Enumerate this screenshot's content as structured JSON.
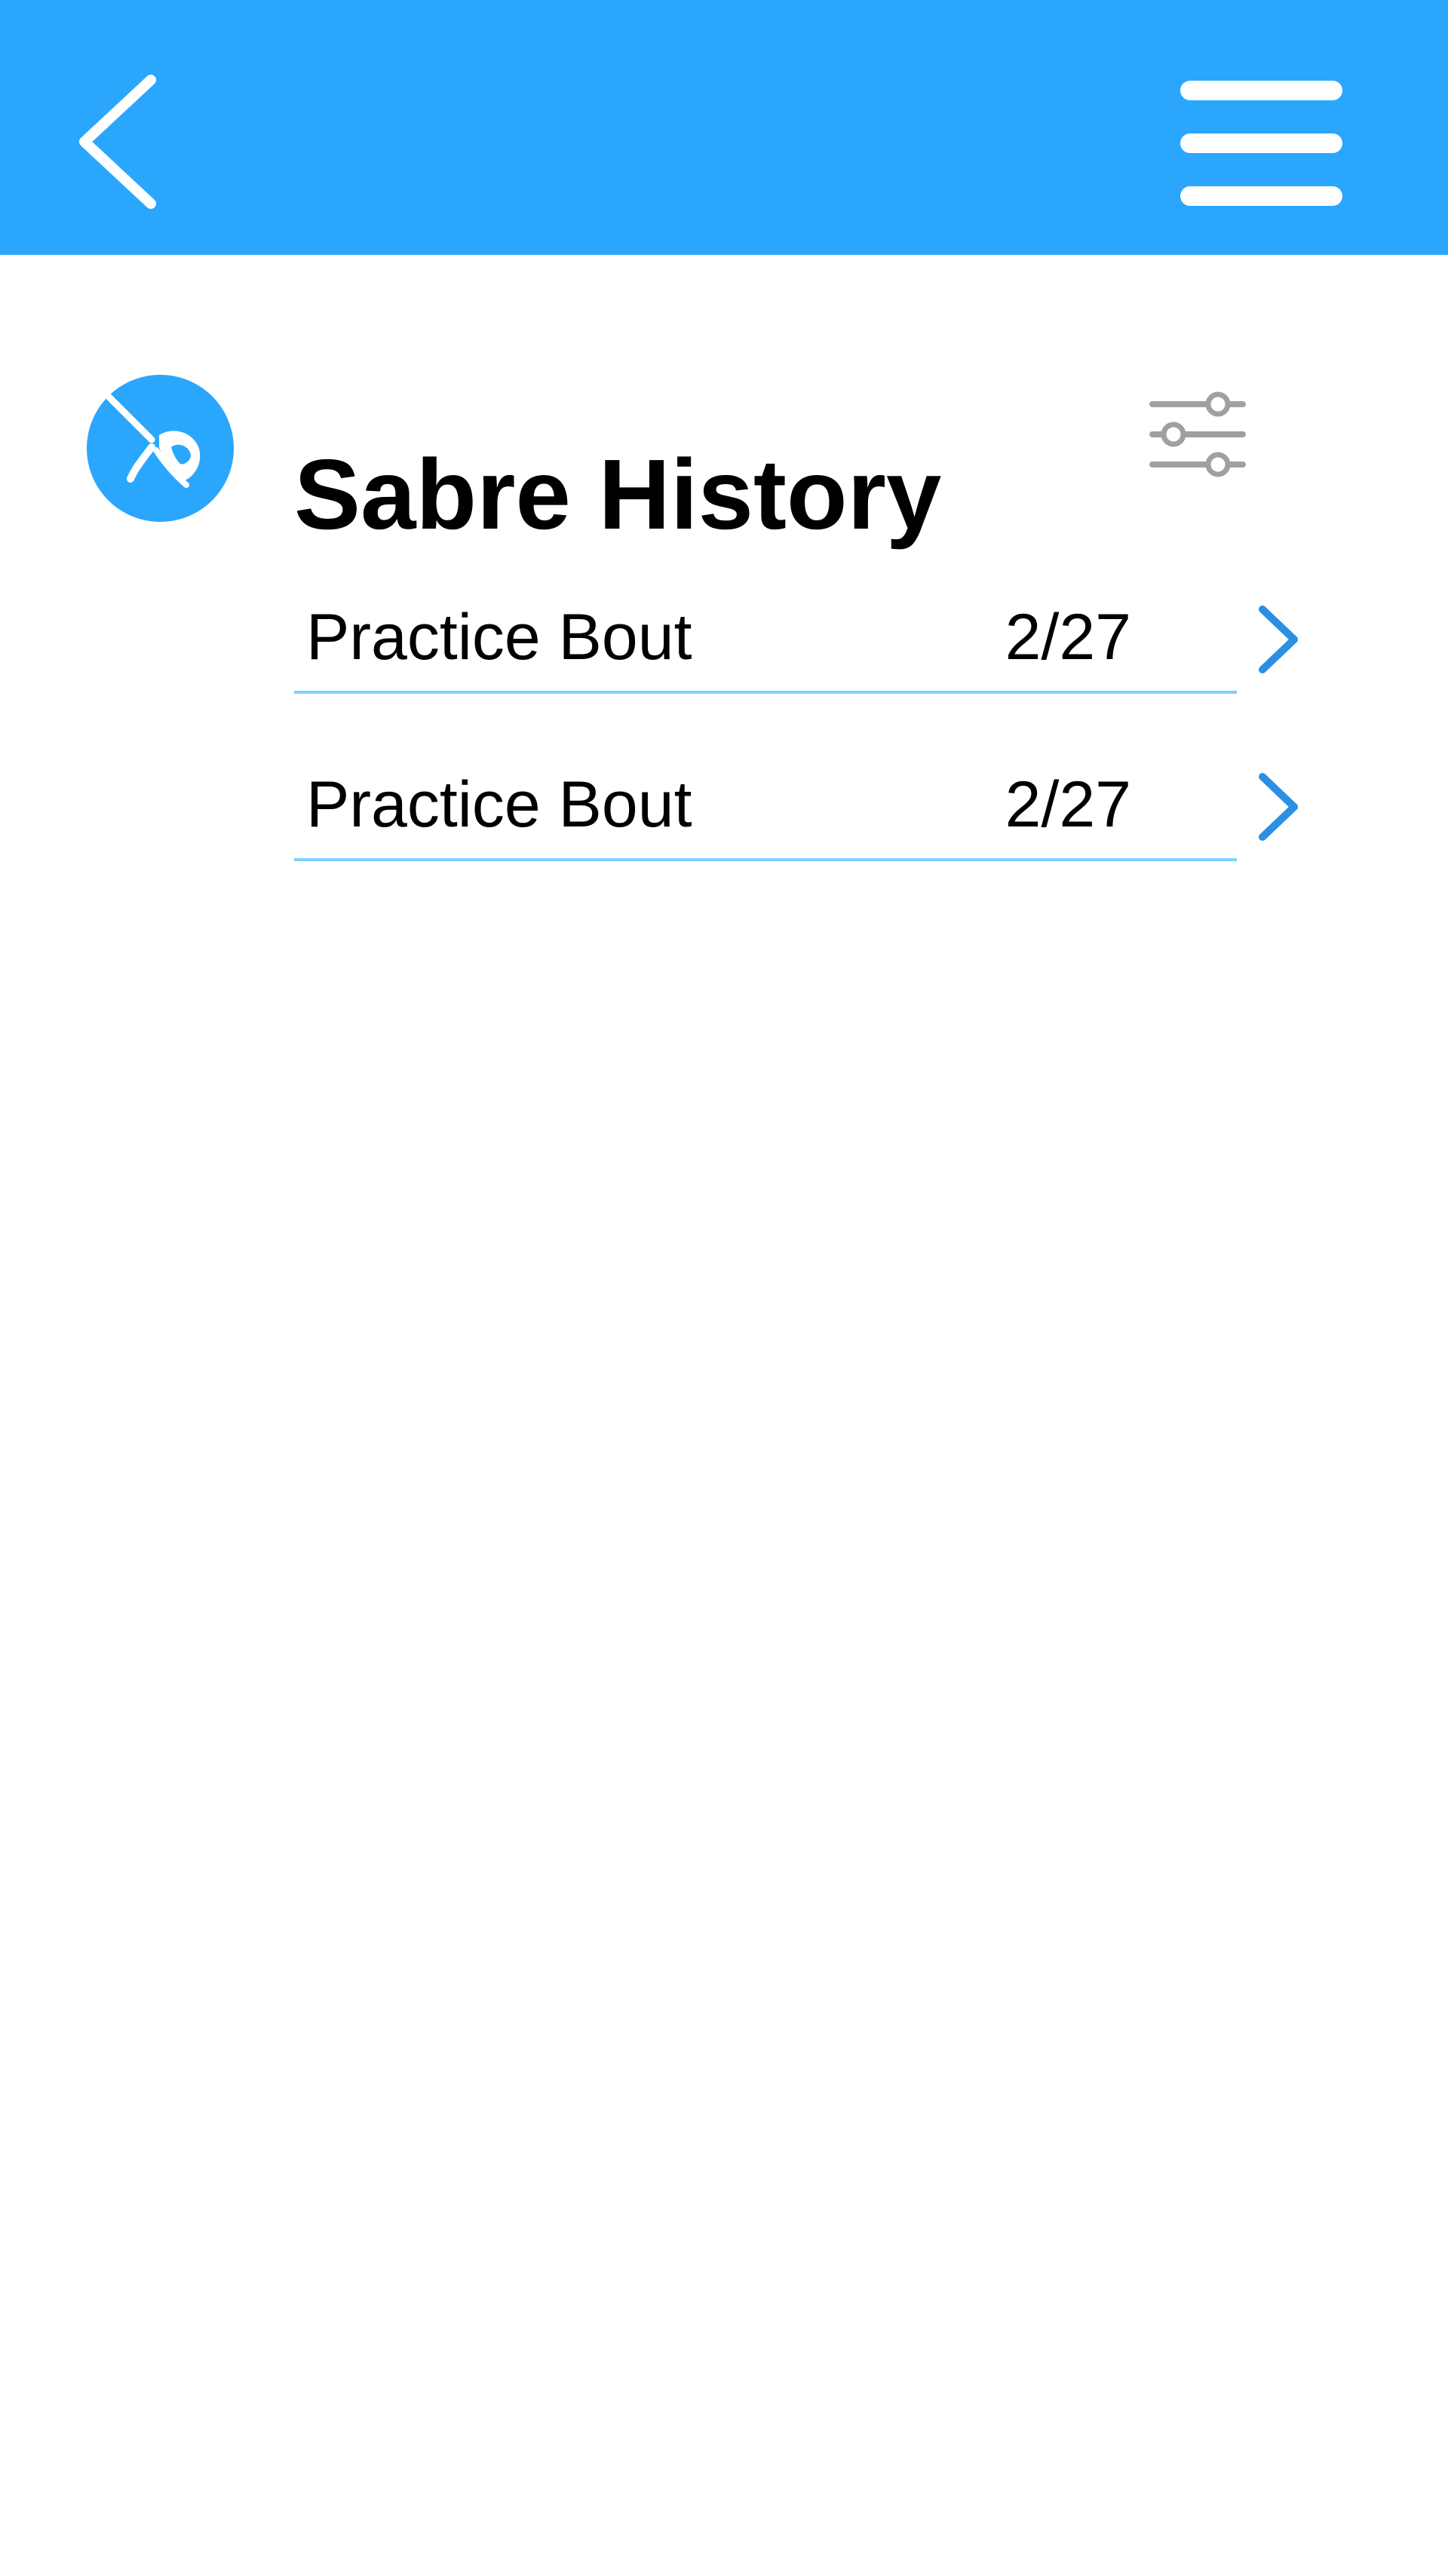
{
  "header": {
    "back_icon": "chevron-left-icon",
    "menu_icon": "hamburger-menu-icon"
  },
  "page": {
    "title": "Sabre History",
    "weapon_icon": "fencing-sabre-icon",
    "filter_icon": "sliders-filter-icon"
  },
  "history": {
    "items": [
      {
        "title": "Practice Bout",
        "date": "2/27"
      },
      {
        "title": "Practice Bout",
        "date": "2/27"
      }
    ]
  },
  "colors": {
    "app_bar": "#2aa7fd",
    "accent": "#2aa7fd",
    "divider": "#7fd0ff",
    "chevron": "#2d8fe4",
    "icon_gray": "#a0a0a0"
  }
}
